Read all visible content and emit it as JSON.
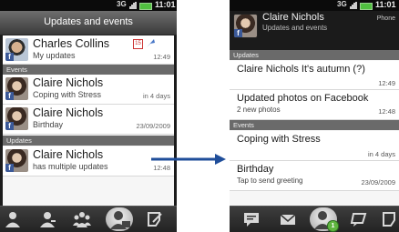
{
  "status": {
    "network": "3G",
    "time": "11:01"
  },
  "left": {
    "title": "Updates and events",
    "top_item": {
      "name": "Charles Collins",
      "sub": "My updates",
      "meta": "12:49",
      "cal_glyph": "15"
    },
    "events_label": "Events",
    "events": [
      {
        "name": "Claire Nichols",
        "sub": "Coping with Stress",
        "meta": "in 4 days"
      },
      {
        "name": "Claire Nichols",
        "sub": "Birthday",
        "meta": "23/09/2009"
      }
    ],
    "updates_label": "Updates",
    "updates": [
      {
        "name": "Claire Nichols",
        "sub": "has multiple updates",
        "meta": "12:48"
      }
    ],
    "fb_badge": "f",
    "tabs": [
      "person-icon",
      "contacts-icon",
      "groups-icon",
      "updates-icon",
      "call-history-icon"
    ]
  },
  "right": {
    "contact_name": "Claire Nichols",
    "contact_sub": "Updates and events",
    "contact_phone": "Phone",
    "updates_label": "Updates",
    "updates": [
      {
        "title": "Claire Nichols It's autumn (?)",
        "sub": "",
        "meta": "12:49"
      },
      {
        "title": "Updated photos on Facebook",
        "sub": "2 new photos",
        "meta": "12:48"
      }
    ],
    "events_label": "Events",
    "events": [
      {
        "title": "Coping with Stress",
        "sub": "",
        "meta": "in 4 days"
      },
      {
        "title": "Birthday",
        "sub": "Tap to send greeting",
        "meta": "23/09/2009"
      }
    ],
    "badge_count": "1",
    "tabs": [
      "message-icon",
      "mail-icon",
      "updates-icon",
      "chat-icon",
      "call-history-icon"
    ]
  },
  "colors": {
    "arrow": "#1f4e9a",
    "facebook": "#3b5998",
    "section": "#6a6a6a",
    "battery": "#50c040"
  }
}
